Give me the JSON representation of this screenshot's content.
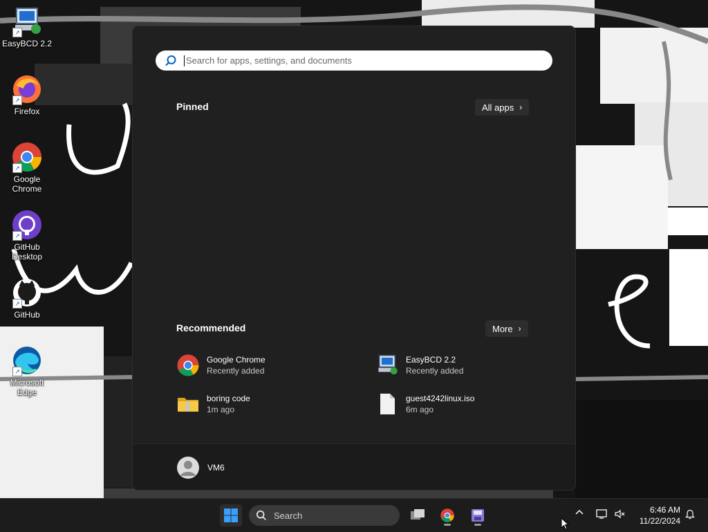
{
  "desktop": {
    "icons": [
      {
        "label": "EasyBCD 2.2",
        "icon": "easybcd-icon"
      },
      {
        "label": "Firefox",
        "icon": "firefox-icon"
      },
      {
        "label": "Google Chrome",
        "icon": "chrome-icon"
      },
      {
        "label": "GitHub Desktop",
        "icon": "github-desktop-icon"
      },
      {
        "label": "GitHub",
        "icon": "github-icon"
      },
      {
        "label": "Microsoft Edge",
        "icon": "edge-icon"
      }
    ]
  },
  "start_menu": {
    "search_placeholder": "Search for apps, settings, and documents",
    "pinned_title": "Pinned",
    "all_apps_label": "All apps",
    "recommended_title": "Recommended",
    "more_label": "More",
    "recommended": [
      {
        "name": "Google Chrome",
        "sub": "Recently added",
        "icon": "chrome-icon"
      },
      {
        "name": "EasyBCD 2.2",
        "sub": "Recently added",
        "icon": "easybcd-icon"
      },
      {
        "name": "boring code",
        "sub": "1m ago",
        "icon": "folder-icon"
      },
      {
        "name": "guest4242linux.iso",
        "sub": "6m ago",
        "icon": "file-icon"
      }
    ],
    "user_name": "VM6"
  },
  "taskbar": {
    "search_label": "Search",
    "time": "6:46 AM",
    "date": "11/22/2024"
  },
  "colors": {
    "start_bg": "#202020",
    "taskbar_bg": "#1c1c1c",
    "accent": "#0078d4",
    "windows_logo": "#3aa0ff"
  }
}
